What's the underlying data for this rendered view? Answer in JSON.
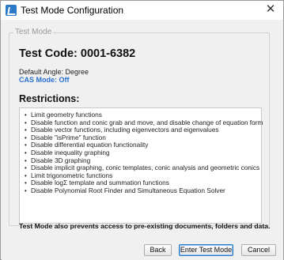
{
  "window": {
    "title": "Test Mode Configuration",
    "close_glyph": "✕"
  },
  "group": {
    "legend": "Test Mode"
  },
  "main": {
    "test_code": "Test Code: 0001-6382",
    "default_angle": "Default Angle: Degree",
    "cas_mode": "CAS Mode: Off",
    "restrictions_title": "Restrictions:",
    "restrictions": [
      "Limit geometry functions",
      "Disable function and conic grab and move, and disable change of equation form",
      "Disable vector functions, including eigenvectors and eigenvalues",
      "Disable \"isPrime\" function",
      "Disable differential equation functionality",
      "Disable inequality graphing",
      "Disable 3D graphing",
      "Disable implicit graphing, conic templates, conic analysis and geometric conics",
      "Limit trigonometric functions",
      "Disable logΣ template and summation functions",
      "Disable Polynomial Root Finder and Simultaneous Equation Solver"
    ],
    "footer_note": "Test Mode also prevents access to pre-existing documents, folders and data."
  },
  "buttons": {
    "back": "Back",
    "enter": "Enter Test Mode",
    "cancel": "Cancel"
  },
  "colors": {
    "cas_text": "#2a6fd1",
    "default_button_border": "#2a7ac8",
    "app_icon": "#2a7ac8"
  },
  "icons": {
    "app": "test-mode-app-icon",
    "close": "close-icon"
  }
}
